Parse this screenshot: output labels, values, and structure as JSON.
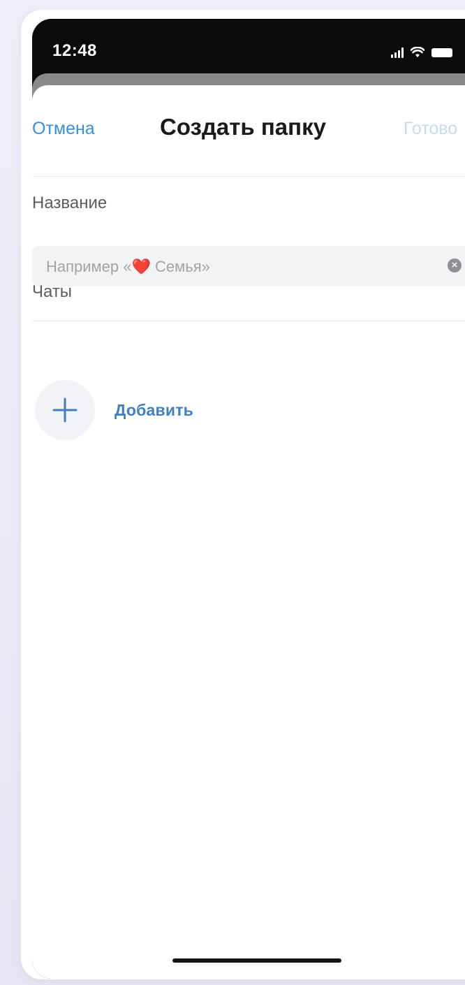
{
  "status_bar": {
    "time": "12:48",
    "icons": [
      "signal-icon",
      "wifi-icon",
      "battery-icon"
    ]
  },
  "nav": {
    "cancel_label": "Отмена",
    "title": "Создать папку",
    "done_label": "Готово"
  },
  "name_section": {
    "label": "Название",
    "input_value": "",
    "input_placeholder": "Например «❤️ Семья»",
    "clear_icon": "clear-icon"
  },
  "chats_section": {
    "label": "Чаты",
    "add_label": "Добавить",
    "add_icon": "plus-icon"
  },
  "colors": {
    "accent": "#3b8fd9",
    "accent_disabled": "#c4dcef",
    "add_text": "#3f7fc4",
    "input_bg": "#f3f3f5"
  }
}
